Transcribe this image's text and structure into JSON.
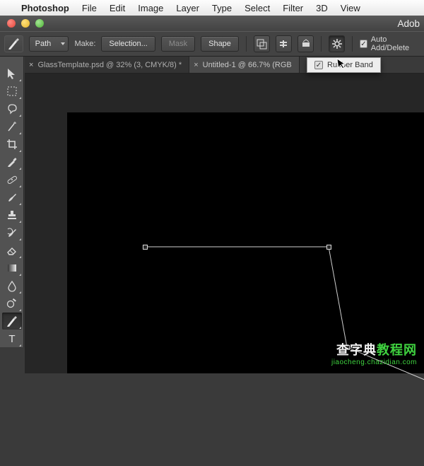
{
  "mac_menu": {
    "app": "Photoshop",
    "items": [
      "File",
      "Edit",
      "Image",
      "Layer",
      "Type",
      "Select",
      "Filter",
      "3D",
      "View"
    ]
  },
  "app_title": "Adob",
  "options": {
    "mode": "Path",
    "make_label": "Make:",
    "selection": "Selection...",
    "mask": "Mask",
    "shape": "Shape",
    "auto_add": "Auto Add/Delete",
    "popup_label": "Rubber Band"
  },
  "tabs": [
    {
      "label": "GlassTemplate.psd @ 32% (3, CMYK/8) *",
      "active": false
    },
    {
      "label": "Untitled-1 @ 66.7% (RGB",
      "active": true
    }
  ],
  "toolbox": [
    {
      "name": "move-tool",
      "svg": "arrow"
    },
    {
      "name": "marquee-tool",
      "svg": "marquee"
    },
    {
      "name": "lasso-tool",
      "svg": "lasso"
    },
    {
      "name": "wand-tool",
      "svg": "wand"
    },
    {
      "name": "crop-tool",
      "svg": "crop"
    },
    {
      "name": "eyedropper-tool",
      "svg": "eyedrop"
    },
    {
      "name": "heal-tool",
      "svg": "bandaid"
    },
    {
      "name": "brush-tool",
      "svg": "brush"
    },
    {
      "name": "stamp-tool",
      "svg": "stamp"
    },
    {
      "name": "history-brush-tool",
      "svg": "histbrush"
    },
    {
      "name": "eraser-tool",
      "svg": "eraser"
    },
    {
      "name": "gradient-tool",
      "svg": "gradient"
    },
    {
      "name": "blur-tool",
      "svg": "drop"
    },
    {
      "name": "dodge-tool",
      "svg": "dodge"
    },
    {
      "name": "pen-tool",
      "svg": "pen",
      "active": true
    },
    {
      "name": "type-tool",
      "svg": "type"
    }
  ],
  "watermark": {
    "line1_a": "查字典",
    "line1_b": "教程网",
    "line2": "jiaocheng.chazidian.com"
  }
}
